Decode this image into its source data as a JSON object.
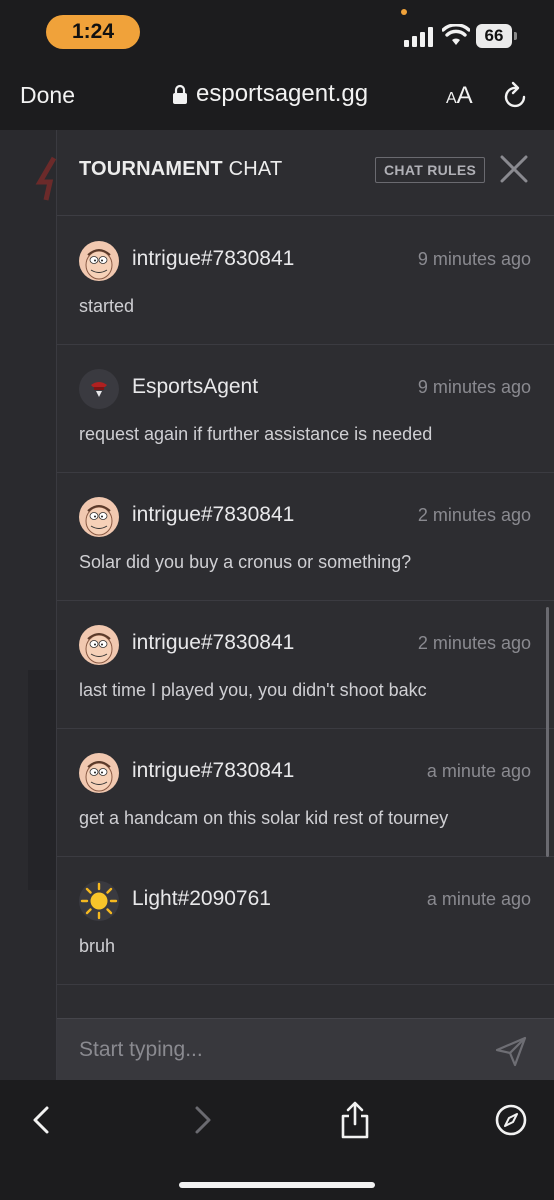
{
  "status_bar": {
    "time": "1:24",
    "battery": "66"
  },
  "browser": {
    "done_label": "Done",
    "url": "esportsagent.gg",
    "text_size_label_small": "A",
    "text_size_label_large": "A"
  },
  "chat": {
    "title_bold": "TOURNAMENT",
    "title_rest": "CHAT",
    "rules_label": "CHAT RULES",
    "input_placeholder": "Start typing...",
    "messages": [
      {
        "user": "intrigue#7830841",
        "time": "9 minutes ago",
        "text": "started",
        "avatar": "cartoon-face-avatar"
      },
      {
        "user": "EsportsAgent",
        "time": "9 minutes ago",
        "text": "request again if further assistance is needed",
        "avatar": "esportsagent-logo-avatar"
      },
      {
        "user": "intrigue#7830841",
        "time": "2 minutes ago",
        "text": "Solar did you buy a cronus or something?",
        "avatar": "cartoon-face-avatar"
      },
      {
        "user": "intrigue#7830841",
        "time": "2 minutes ago",
        "text": "last time I played you, you didn't shoot bakc",
        "avatar": "cartoon-face-avatar"
      },
      {
        "user": "intrigue#7830841",
        "time": "a minute ago",
        "text": "get a handcam on this solar kid rest of tourney",
        "avatar": "cartoon-face-avatar"
      },
      {
        "user": "Light#2090761",
        "time": "a minute ago",
        "text": "bruh",
        "avatar": "sun-avatar"
      }
    ]
  },
  "colors": {
    "accent": "#f0a23a",
    "panel": "#2d2d31",
    "background": "#1c1c1e"
  },
  "icons": [
    "lock-icon",
    "reload-icon",
    "close-icon",
    "send-icon",
    "back-icon",
    "forward-icon",
    "share-icon",
    "compass-icon"
  ]
}
